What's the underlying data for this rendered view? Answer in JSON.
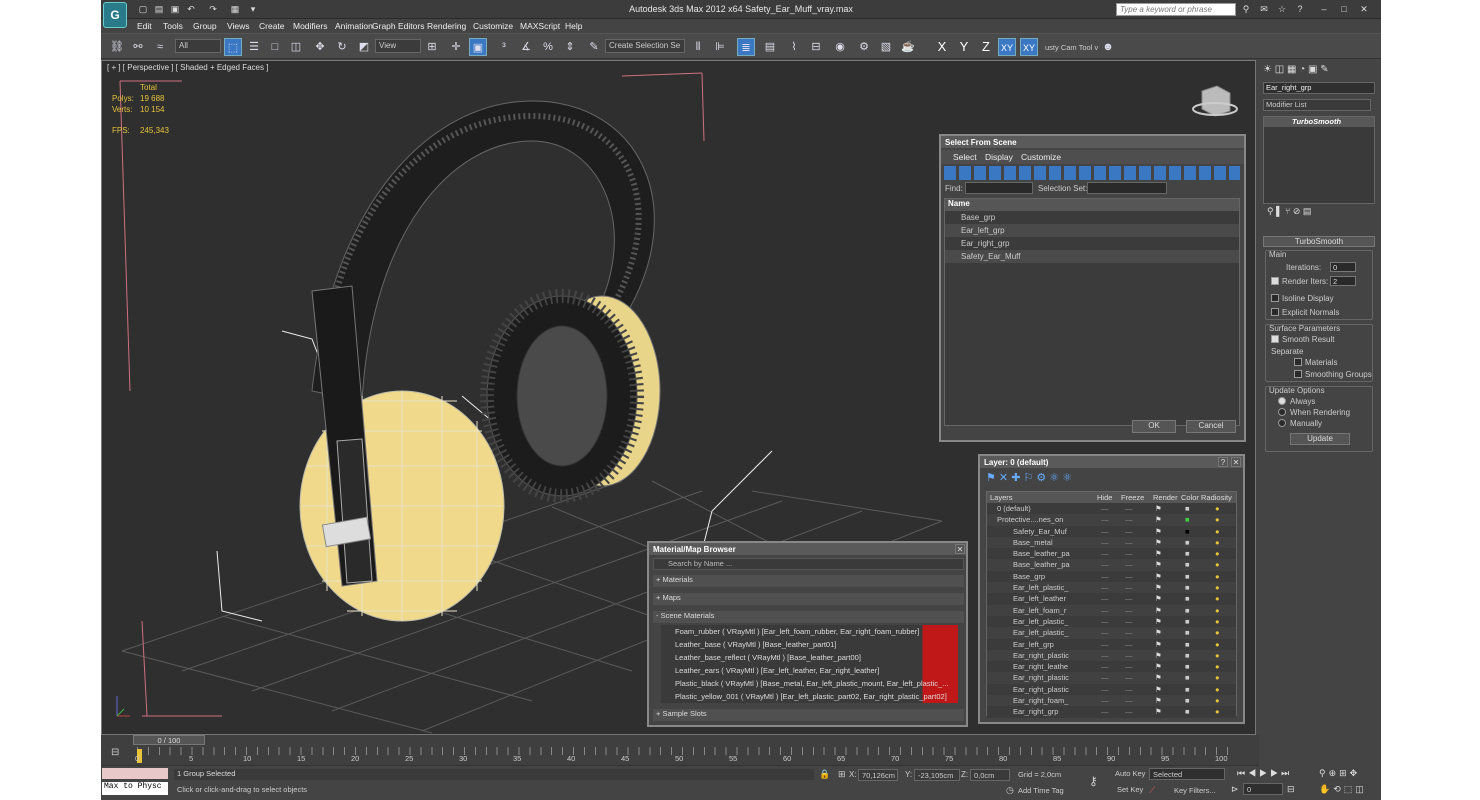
{
  "window": {
    "title": "Autodesk 3ds Max  2012 x64      Safety_Ear_Muff_vray.max",
    "logo": "3ds-max-logo"
  },
  "search": {
    "placeholder": "Type a keyword or phrase"
  },
  "menus": [
    "Edit",
    "Tools",
    "Group",
    "Views",
    "Create",
    "Modifiers",
    "Animation",
    "Graph Editors",
    "Rendering",
    "Customize",
    "MAXScript",
    "Help"
  ],
  "toolbar": {
    "filter": "All",
    "ref_coord": "View",
    "selection_set": "Create Selection Se",
    "axes": [
      "X",
      "Y",
      "Z",
      "XY",
      "XY"
    ],
    "cam_tool": "usty Cam Tool v"
  },
  "viewport": {
    "label": "[ + ] [ Perspective ] [ Shaded + Edged Faces ]",
    "stats": {
      "header": "Total",
      "polys_label": "Polys:",
      "polys": "19 688",
      "verts_label": "Verts:",
      "verts": "10 154",
      "fps_label": "FPS:",
      "fps": "245,343"
    }
  },
  "command_panel": {
    "object_name": "Ear_right_grp",
    "modifier_list": "Modifier List",
    "modifier": "TurboSmooth",
    "rollout_title": "TurboSmooth",
    "main": "Main",
    "iterations_label": "Iterations:",
    "iterations": "0",
    "render_iters_label": "Render Iters:",
    "render_iters": "2",
    "isoline": "Isoline Display",
    "explicit": "Explicit Normals",
    "surface_params": "Surface Parameters",
    "smooth_result": "Smooth Result",
    "separate": "Separate",
    "materials": "Materials",
    "smoothing_groups": "Smoothing Groups",
    "update_options": "Update Options",
    "always": "Always",
    "when_rendering": "When Rendering",
    "manually": "Manually",
    "update": "Update"
  },
  "select_dialog": {
    "title": "Select From Scene",
    "menus": [
      "Select",
      "Display",
      "Customize"
    ],
    "find_label": "Find:",
    "selection_set_label": "Selection Set:",
    "col_name": "Name",
    "items": [
      "Base_grp",
      "Ear_left_grp",
      "Ear_right_grp",
      "Safety_Ear_Muff"
    ],
    "ok": "OK",
    "cancel": "Cancel"
  },
  "layer_dialog": {
    "title": "Layer: 0 (default)",
    "help": "?",
    "columns": [
      "Layers",
      "Hide",
      "Freeze",
      "Render",
      "Color",
      "Radiosity"
    ],
    "rows": [
      "0 (default)",
      "Protective....nes_on",
      "Safety_Ear_Muf",
      "Base_metal",
      "Base_leather_pa",
      "Base_leather_pa",
      "Base_grp",
      "Ear_left_plastic_",
      "Ear_left_leather",
      "Ear_left_foam_r",
      "Ear_left_plastic_",
      "Ear_left_plastic_",
      "Ear_left_grp",
      "Ear_right_plastic",
      "Ear_right_leathe",
      "Ear_right_plastic",
      "Ear_right_plastic",
      "Ear_right_foam_",
      "Ear_right_grp"
    ]
  },
  "material_browser": {
    "title": "Material/Map Browser",
    "search": "Search by Name ...",
    "materials": "+ Materials",
    "maps": "+ Maps",
    "scene_materials": "- Scene Materials",
    "sample_slots": "+ Sample Slots",
    "items": [
      "Foam_rubber  ( VRayMtl ) [Ear_left_foam_rubber, Ear_right_foam_rubber]",
      "Leather_base  ( VRayMtl ) [Base_leather_part01]",
      "Leather_base_reflect  ( VRayMtl ) [Base_leather_part00]",
      "Leather_ears  ( VRayMtl ) [Ear_left_leather, Ear_right_leather]",
      "Plastic_black  ( VRayMtl ) [Base_metal, Ear_left_plastic_mount, Ear_left_plastic_...",
      "Plastic_yellow_001  ( VRayMtl ) [Ear_left_plastic_part02, Ear_right_plastic_part02]"
    ]
  },
  "timeline": {
    "frame": "0 / 100",
    "ticks": [
      "0",
      "5",
      "10",
      "15",
      "20",
      "25",
      "30",
      "35",
      "40",
      "45",
      "50",
      "55",
      "60",
      "65",
      "70",
      "75",
      "80",
      "85",
      "90",
      "95",
      "100"
    ]
  },
  "status": {
    "maxscript": "Max to Physc",
    "selected": "1 Group Selected",
    "prompt": "Click or click-and-drag to select objects",
    "x_label": "X:",
    "x": "70,126cm",
    "y_label": "Y:",
    "y": "-23,105cm",
    "z_label": "Z:",
    "z": "0,0cm",
    "grid": "Grid = 2,0cm",
    "add_time_tag": "Add Time Tag",
    "auto_key": "Auto Key",
    "set_key": "Set Key",
    "key_mode": "Selected",
    "key_filters": "Key Filters...",
    "frame_field": "0"
  },
  "colors": {
    "accent": "#3a78c4",
    "stats": "#e8c43a",
    "yellow_cup": "#f0d98a"
  }
}
